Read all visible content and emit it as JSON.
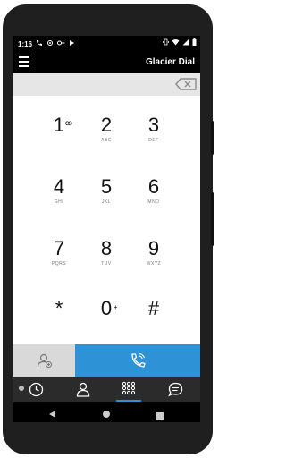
{
  "status_bar": {
    "time": "1:16",
    "icons": [
      "phone-forward-icon",
      "location-icon",
      "key-icon",
      "play-icon"
    ],
    "right_icons": [
      "vibrate-icon",
      "wifi-icon",
      "signal-icon",
      "battery-icon"
    ]
  },
  "app_bar": {
    "title": "Glacier Dial",
    "menu_icon": "hamburger-icon"
  },
  "number_field": {
    "value": ""
  },
  "keypad": [
    {
      "digit": "1",
      "letters": "",
      "sup": "ꝏ"
    },
    {
      "digit": "2",
      "letters": "ABC",
      "sup": ""
    },
    {
      "digit": "3",
      "letters": "DEF",
      "sup": ""
    },
    {
      "digit": "4",
      "letters": "GHI",
      "sup": ""
    },
    {
      "digit": "5",
      "letters": "JKL",
      "sup": ""
    },
    {
      "digit": "6",
      "letters": "MNO",
      "sup": ""
    },
    {
      "digit": "7",
      "letters": "PQRS",
      "sup": ""
    },
    {
      "digit": "8",
      "letters": "TUV",
      "sup": ""
    },
    {
      "digit": "9",
      "letters": "WXYZ",
      "sup": ""
    },
    {
      "digit": "*",
      "letters": "",
      "sup": ""
    },
    {
      "digit": "0",
      "letters": "",
      "sup": "+"
    },
    {
      "digit": "#",
      "letters": "",
      "sup": ""
    }
  ],
  "action_row": {
    "contact_icon": "add-contact-icon",
    "call_icon": "wifi-call-icon"
  },
  "tabs": [
    {
      "name": "recents",
      "icon": "clock-icon",
      "active": false
    },
    {
      "name": "contacts",
      "icon": "person-icon",
      "active": false
    },
    {
      "name": "dialpad",
      "icon": "dialpad-icon",
      "active": true
    },
    {
      "name": "messages",
      "icon": "chat-icon",
      "active": false
    }
  ],
  "colors": {
    "accent": "#2e93d6",
    "tabbar": "#2b2b2b",
    "field": "#e6e6e6",
    "contact_bg": "#d9d9d9"
  }
}
